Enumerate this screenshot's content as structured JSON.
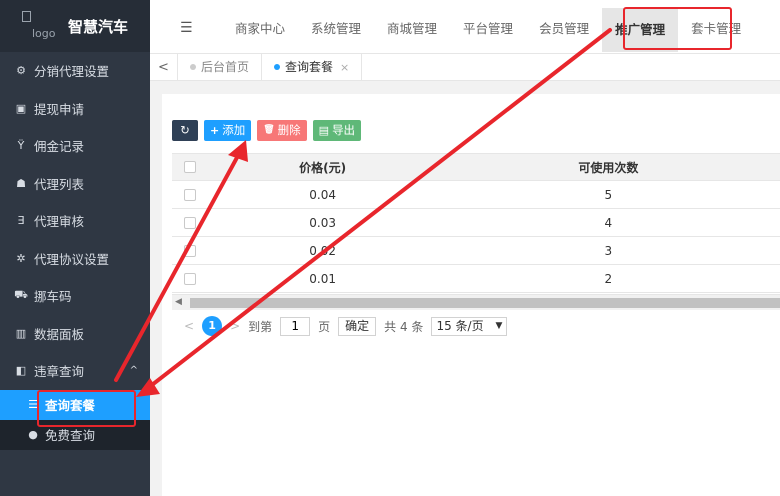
{
  "sidebar": {
    "logo_alt": "logo",
    "title": "智慧汽车",
    "items": [
      {
        "label": "分销代理设置",
        "icon": "gear-icon",
        "glyph": "⚙"
      },
      {
        "label": "提现申请",
        "icon": "money-icon",
        "glyph": "▣"
      },
      {
        "label": "佣金记录",
        "icon": "glass-icon",
        "glyph": "Ϋ"
      },
      {
        "label": "代理列表",
        "icon": "users-icon",
        "glyph": "☗"
      },
      {
        "label": "代理审核",
        "icon": "css3-icon",
        "glyph": "∃"
      },
      {
        "label": "代理协议设置",
        "icon": "settings-icon",
        "glyph": "✲"
      },
      {
        "label": "挪车码",
        "icon": "car-icon",
        "glyph": "⛟"
      },
      {
        "label": "数据面板",
        "icon": "bar-chart-icon",
        "glyph": "▥"
      },
      {
        "label": "违章查询",
        "icon": "ticket-icon",
        "glyph": "◧",
        "caret": "^"
      }
    ],
    "sub_items": [
      {
        "label": "查询套餐",
        "icon": "list-icon",
        "glyph": "☰",
        "active": true
      },
      {
        "label": "免费查询",
        "icon": "coin-icon",
        "glyph": "●",
        "active": false
      }
    ]
  },
  "topbar": {
    "menu_icon": "☰",
    "nav": [
      "商家中心",
      "系统管理",
      "商城管理",
      "平台管理",
      "会员管理",
      "推广管理",
      "套卡管理"
    ],
    "active_index": 5
  },
  "tabs": {
    "back_glyph": "<",
    "items": [
      {
        "label": "后台首页",
        "active": false
      },
      {
        "label": "查询套餐",
        "active": true,
        "close": "×"
      }
    ]
  },
  "toolbar": {
    "refresh_glyph": "↻",
    "add_label": "添加",
    "add_glyph": "+",
    "delete_label": "删除",
    "delete_glyph": "🗑",
    "export_label": "导出",
    "export_glyph": "▤"
  },
  "table": {
    "headers": {
      "price": "价格(元)",
      "times": "可使用次数"
    },
    "rows": [
      {
        "price": "0.04",
        "times": "5"
      },
      {
        "price": "0.03",
        "times": "4"
      },
      {
        "price": "0.02",
        "times": "3"
      },
      {
        "price": "0.01",
        "times": "2"
      }
    ]
  },
  "pager": {
    "prev": "<",
    "current": "1",
    "next": ">",
    "goto_label": "到第",
    "page_value": "1",
    "page_unit": "页",
    "confirm_label": "确定",
    "total_label": "共 4 条",
    "page_size": "15 条/页",
    "dd": "▼"
  },
  "colors": {
    "sidebar_bg": "#2f3743",
    "active_blue": "#1e9fff",
    "annotation_red": "#e8262c"
  }
}
